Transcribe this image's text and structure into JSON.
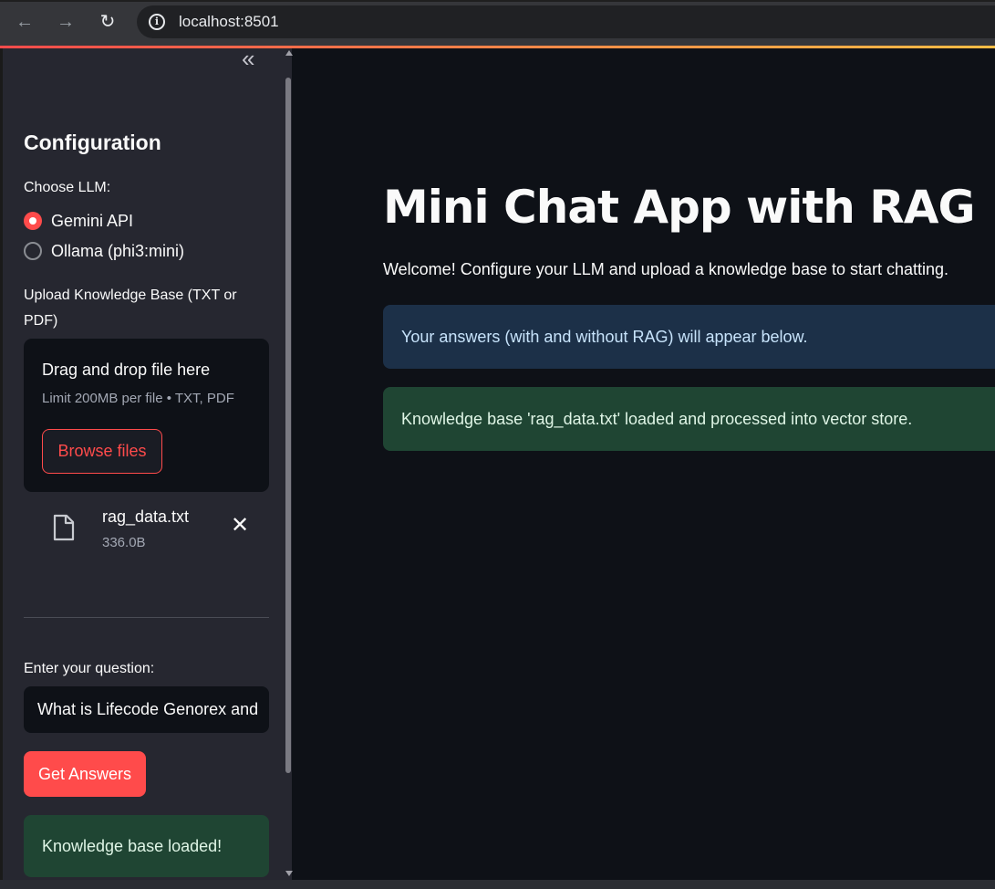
{
  "browser": {
    "url": "localhost:8501",
    "back_glyph": "←",
    "forward_glyph": "→",
    "reload_glyph": "↻",
    "info_glyph": "i"
  },
  "sidebar": {
    "collapse_glyph": "«",
    "title": "Configuration",
    "llm_label": "Choose LLM:",
    "llm_options": [
      {
        "label": "Gemini API",
        "selected": true
      },
      {
        "label": "Ollama (phi3:mini)",
        "selected": false
      }
    ],
    "upload_label_line1": "Upload Knowledge Base (TXT or",
    "upload_label_line2": "PDF)",
    "dropzone": {
      "title": "Drag and drop file here",
      "limit": "Limit 200MB per file • TXT, PDF",
      "browse_label": "Browse files"
    },
    "uploaded_file": {
      "name": "rag_data.txt",
      "size": "336.0B",
      "remove_glyph": "✕"
    },
    "question_label": "Enter your question:",
    "question_value": "What is Lifecode Genorex and",
    "submit_label": "Get Answers",
    "status_message": "Knowledge base loaded!"
  },
  "main": {
    "title": "Mini Chat App with RAG",
    "welcome": "Welcome! Configure your LLM and upload a knowledge base to start chatting.",
    "info_message": "Your answers (with and without RAG) will appear below.",
    "success_message": "Knowledge base 'rag_data.txt' loaded and processed into vector store."
  },
  "colors": {
    "accent": "#ff4b4b",
    "sidebar_bg": "#262730",
    "main_bg": "#0e1117",
    "info_bg": "#1c3048",
    "success_bg": "#1f4533"
  }
}
